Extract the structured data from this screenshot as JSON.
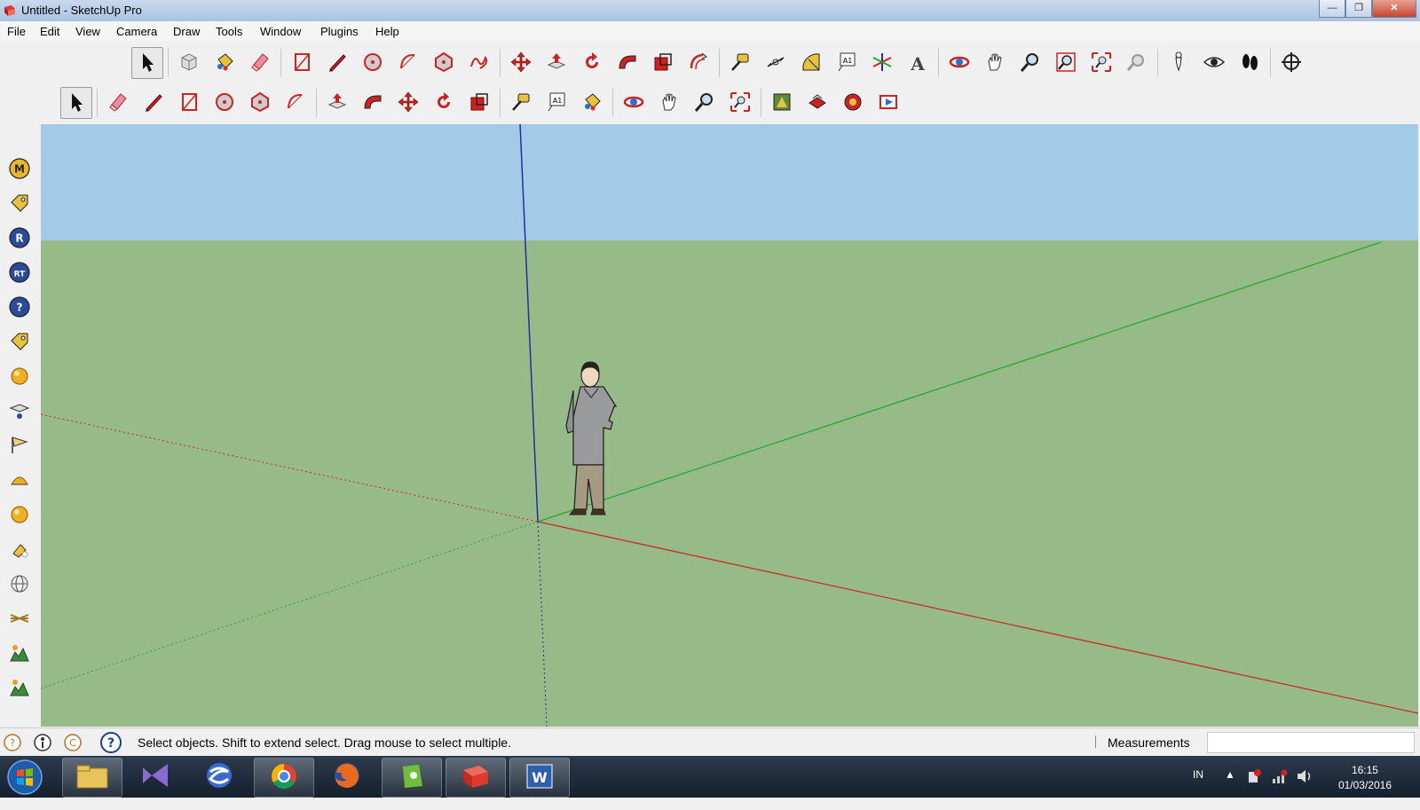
{
  "window": {
    "title": "Untitled - SketchUp Pro",
    "min_label": "—",
    "max_label": "❐",
    "close_label": "✕"
  },
  "menu": [
    "File",
    "Edit",
    "View",
    "Camera",
    "Draw",
    "Tools",
    "Window",
    "Plugins",
    "Help"
  ],
  "toolbar_top": [
    "select-icon",
    "component-icon",
    "paint-bucket-icon",
    "eraser-icon",
    "rectangle-icon",
    "pencil-icon",
    "circle-icon",
    "arc-icon",
    "polygon-icon",
    "freehand-icon",
    "move-icon",
    "push-pull-icon",
    "rotate-icon",
    "follow-me-icon",
    "scale-icon",
    "offset-icon",
    "tape-measure-icon",
    "dimension-icon",
    "protractor-icon",
    "text-icon",
    "axes-icon",
    "3d-text-icon",
    "orbit-icon",
    "pan-icon",
    "zoom-icon",
    "zoom-window-icon",
    "zoom-extents-icon",
    "previous-view-icon",
    "position-camera-icon",
    "look-around-icon",
    "walk-icon",
    "section-plane-icon"
  ],
  "toolbar_second": [
    "select-icon",
    "eraser-icon",
    "pencil-icon",
    "rectangle-icon",
    "circle-icon",
    "polygon-icon",
    "arc-icon",
    "push-pull-icon",
    "follow-me-icon",
    "move-icon",
    "rotate-icon",
    "scale-icon",
    "tape-measure-icon",
    "text-icon",
    "paint-bucket-icon",
    "orbit-icon",
    "pan-icon",
    "zoom-icon",
    "zoom-extents-icon",
    "get-models-icon",
    "share-model-icon",
    "share-component-icon",
    "extension-warehouse-icon"
  ],
  "toolbar_left": [
    {
      "icon": "plugin-m-icon",
      "label": "M"
    },
    {
      "icon": "tag-icon",
      "label": ""
    },
    {
      "icon": "plugin-r-icon",
      "label": "R"
    },
    {
      "icon": "plugin-rt-icon",
      "label": "RT"
    },
    {
      "icon": "help-icon",
      "label": "?"
    },
    {
      "icon": "tag-2-icon",
      "label": ""
    },
    {
      "icon": "sphere-icon",
      "label": ""
    },
    {
      "icon": "sandbox-icon",
      "label": ""
    },
    {
      "icon": "flag-icon",
      "label": ""
    },
    {
      "icon": "dome-icon",
      "label": ""
    },
    {
      "icon": "sphere-2-icon",
      "label": ""
    },
    {
      "icon": "light-icon",
      "label": ""
    },
    {
      "icon": "globe-icon",
      "label": ""
    },
    {
      "icon": "grid-icon",
      "label": ""
    },
    {
      "icon": "landscape-icon",
      "label": ""
    },
    {
      "icon": "landscape-2-icon",
      "label": ""
    }
  ],
  "colors": {
    "sky": "#a3cbe8",
    "ground": "#97bb88",
    "red_axis": "#cc2a2a",
    "green_axis": "#2fa52f",
    "blue_axis": "#1f2fa0"
  },
  "status": {
    "message": "Select objects. Shift to extend select. Drag mouse to select multiple.",
    "measurements_label": "Measurements",
    "measurements_value": ""
  },
  "taskbar": {
    "apps": [
      "file-explorer-icon",
      "visual-studio-icon",
      "swirl-app-icon",
      "chrome-icon",
      "firefox-icon",
      "evernote-icon",
      "sketchup-icon",
      "word-icon"
    ],
    "active_app": "sketchup-icon",
    "lang": "IN",
    "time": "16:15",
    "date": "01/03/2016"
  }
}
